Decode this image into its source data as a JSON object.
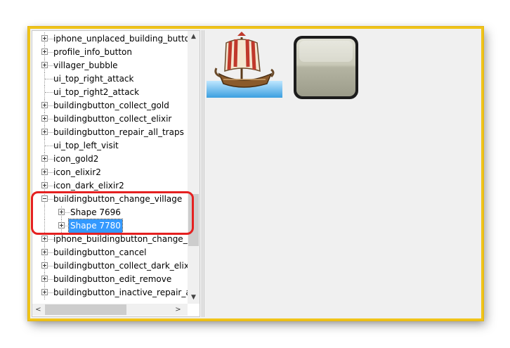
{
  "tree": {
    "items": [
      {
        "label": "iphone_unplaced_building_butto",
        "expander": "plus",
        "level": 0
      },
      {
        "label": "profile_info_button",
        "expander": "plus",
        "level": 0
      },
      {
        "label": "villager_bubble",
        "expander": "plus",
        "level": 0
      },
      {
        "label": "ui_top_right_attack",
        "expander": "none",
        "level": 0
      },
      {
        "label": "ui_top_right2_attack",
        "expander": "none",
        "level": 0
      },
      {
        "label": "buildingbutton_collect_gold",
        "expander": "plus",
        "level": 0
      },
      {
        "label": "buildingbutton_collect_elixir",
        "expander": "plus",
        "level": 0
      },
      {
        "label": "buildingbutton_repair_all_traps",
        "expander": "plus",
        "level": 0
      },
      {
        "label": "ui_top_left_visit",
        "expander": "none",
        "level": 0
      },
      {
        "label": "icon_gold2",
        "expander": "plus",
        "level": 0
      },
      {
        "label": "icon_elixir2",
        "expander": "plus",
        "level": 0
      },
      {
        "label": "icon_dark_elixir2",
        "expander": "plus",
        "level": 0
      },
      {
        "label": "buildingbutton_change_village",
        "expander": "minus",
        "level": 0
      },
      {
        "label": "Shape 7696",
        "expander": "plus",
        "level": 1
      },
      {
        "label": "Shape 7780",
        "expander": "plus",
        "level": 1,
        "selected": true
      },
      {
        "label": "iphone_buildingbutton_change_v",
        "expander": "plus",
        "level": 0
      },
      {
        "label": "buildingbutton_cancel",
        "expander": "plus",
        "level": 0
      },
      {
        "label": "buildingbutton_collect_dark_elixi",
        "expander": "plus",
        "level": 0
      },
      {
        "label": "buildingbutton_edit_remove",
        "expander": "plus",
        "level": 0
      },
      {
        "label": "buildingbutton_inactive_repair_al",
        "expander": "plus",
        "level": 0
      }
    ]
  },
  "scrollbars": {
    "vertical": {
      "up": "▲",
      "down": "▼",
      "position": 0.6
    },
    "horizontal": {
      "left": "<",
      "right": ">",
      "position": 0.1
    }
  },
  "colors": {
    "frame": "#f0c419",
    "highlight": "#e52020",
    "selection": "#3399ff"
  },
  "preview": {
    "images": [
      "ship-icon",
      "blank-button-shape"
    ]
  }
}
